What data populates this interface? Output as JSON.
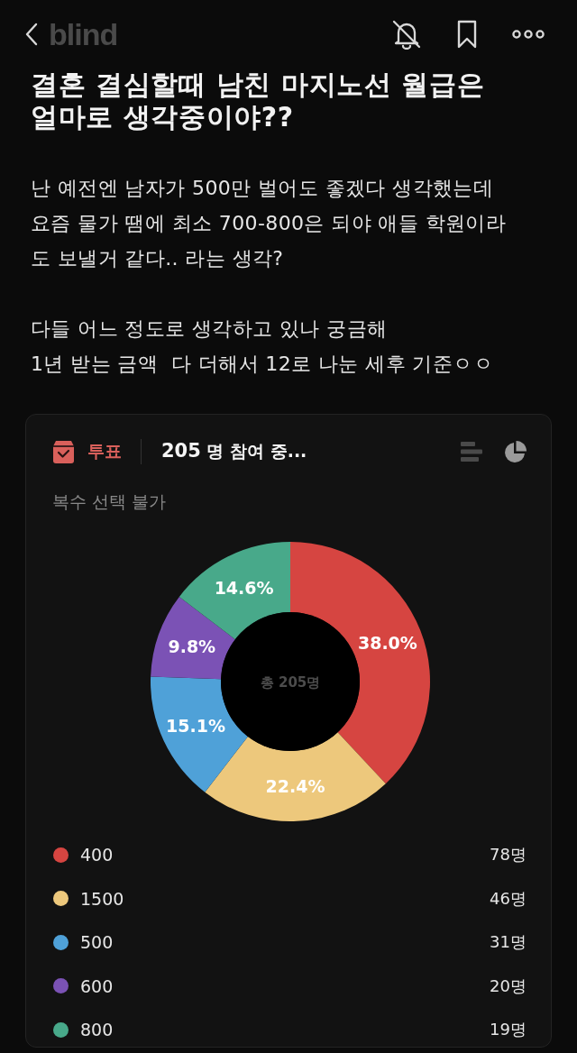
{
  "header": {
    "logo": "blind"
  },
  "post": {
    "title": [
      "결혼 결심할때 남친 마지노선 월급은",
      "얼마로 생각중이야??"
    ],
    "paragraphs": [
      [
        "난 예전엔 남자가 500만 벌어도 좋겠다 생각했는데",
        "요즘 물가 땜에 최소 700-800은 되야 애들 학원이라",
        "도 보낼거 같다.. 라는 생각?"
      ],
      [
        "다들 어느 정도로 생각하고 있나 궁금해",
        "1년 받는 금액  다 더해서 12로 나눈 세후 기준ㅇㅇ"
      ]
    ]
  },
  "poll": {
    "tag": "투표",
    "participants": "**205** 명 참여 중...",
    "views": [
      {
        "kind": "list",
        "selected": false
      },
      {
        "kind": "pie",
        "selected": true
      }
    ],
    "rule": "복수 선택 불가",
    "center_label": "총 205명",
    "chart_data": {
      "type": "donut",
      "categories": [
        "400",
        "1500",
        "500",
        "600",
        "800"
      ],
      "values": [
        38.0,
        22.4,
        15.1,
        9.8,
        14.6
      ],
      "value_labels": [
        "38.0%",
        "22.4%",
        "15.1%",
        "9.8%",
        "14.6%"
      ],
      "legend": "bottom"
    },
    "options": [
      {
        "count": "78명",
        "color": "#d64541"
      },
      {
        "count": "46명",
        "color": "#edc87c"
      },
      {
        "count": "31명",
        "color": "#4fa1d8"
      },
      {
        "count": "20명",
        "color": "#7b52b5"
      },
      {
        "count": "19명",
        "color": "#48a98a"
      }
    ]
  }
}
